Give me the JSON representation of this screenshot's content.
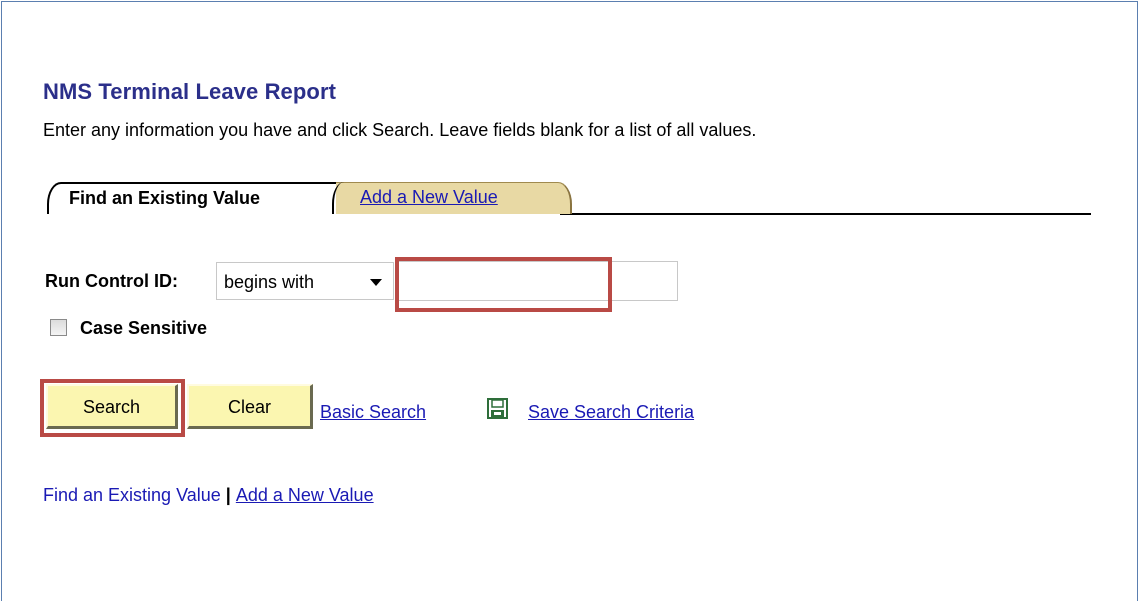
{
  "page": {
    "title": "NMS Terminal Leave Report",
    "instructions": "Enter any information you have and click Search. Leave fields blank for a list of all values."
  },
  "tabs": [
    {
      "label": "Find an Existing Value",
      "active": true
    },
    {
      "label": "Add a New Value",
      "active": false
    }
  ],
  "search_form": {
    "run_control_label": "Run Control ID:",
    "operator_selected": "begins with",
    "run_control_value": "",
    "case_sensitive_label": "Case Sensitive",
    "case_sensitive_checked": false
  },
  "buttons": {
    "search": "Search",
    "clear": "Clear"
  },
  "links": {
    "basic_search": "Basic Search",
    "save_search_criteria": "Save Search Criteria",
    "find_existing": "Find an Existing Value",
    "add_new": "Add a New Value"
  },
  "icons": {
    "save": "floppy-disk-icon"
  },
  "colors": {
    "title": "#2b2f8a",
    "link": "#1a1ab4",
    "button_bg": "#fbf6b0",
    "inactive_tab_bg": "#e8d9a4",
    "highlight_border": "#b94a45"
  }
}
